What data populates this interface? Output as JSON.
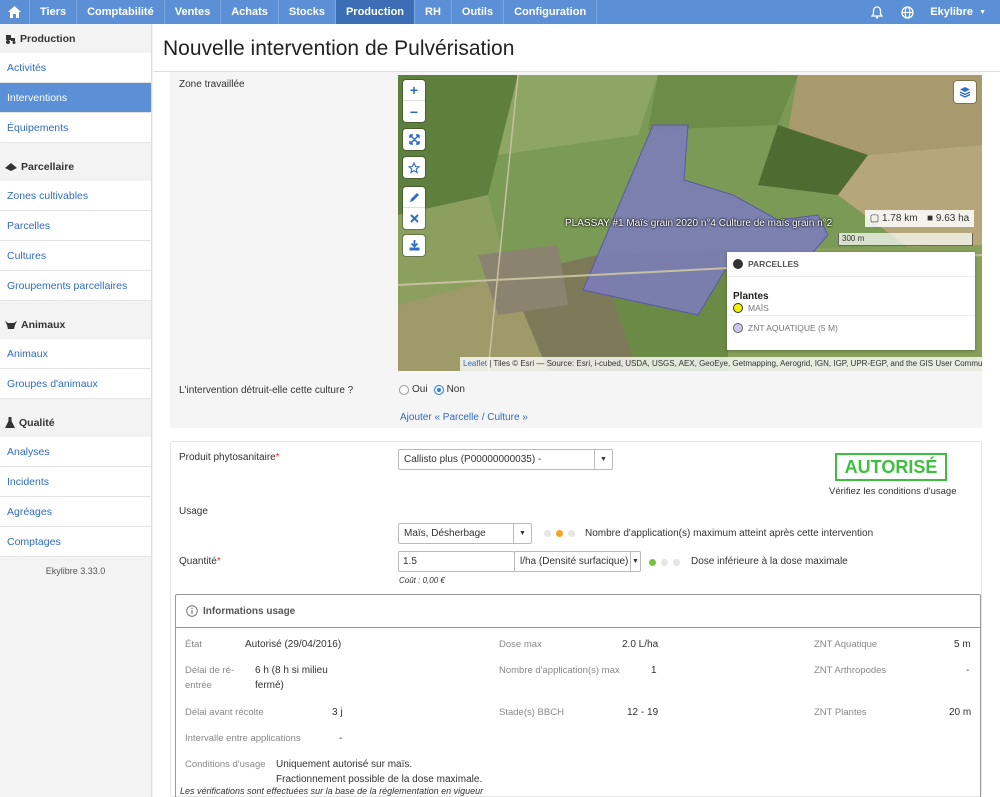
{
  "topnav": {
    "items": [
      "Tiers",
      "Comptabilité",
      "Ventes",
      "Achats",
      "Stocks",
      "Production",
      "RH",
      "Outils",
      "Configuration"
    ],
    "active": "Production",
    "user": "Ekylibre",
    "accent": "#5b8fd6"
  },
  "sidebar": {
    "sections": [
      {
        "title": "Production",
        "icon": "tractor-icon",
        "items": [
          "Activités",
          "Interventions",
          "Équipements"
        ],
        "active": "Interventions"
      },
      {
        "title": "Parcellaire",
        "icon": "land-icon",
        "items": [
          "Zones cultivables",
          "Parcelles",
          "Cultures",
          "Groupements parcellaires"
        ]
      },
      {
        "title": "Animaux",
        "icon": "cow-icon",
        "items": [
          "Animaux",
          "Groupes d'animaux"
        ]
      },
      {
        "title": "Qualité",
        "icon": "flask-icon",
        "items": [
          "Analyses",
          "Incidents",
          "Agréages",
          "Comptages"
        ]
      }
    ],
    "version": "Ekylibre 3.33.0"
  },
  "page": {
    "title": "Nouvelle intervention de Pulvérisation"
  },
  "zone": {
    "label": "Zone travaillée",
    "map_label": "PLASSAY #1 Maïs grain 2020 n°4 Culture de maïs grain n°2",
    "length": "1.78 km",
    "area": "9.63 ha",
    "scale": "300 m",
    "legend": {
      "parcelles": "PARCELLES",
      "plantes_title": "Plantes",
      "mais": "MAÏS",
      "znt": "ZNT AQUATIQUE (5 M)"
    },
    "attribution_link": "Leaflet",
    "attribution_text": " | Tiles © Esri — Source: Esri, i-cubed, USDA, USGS, AEX, GeoEye, Getmapping, Aerogrid, IGN, IGP, UPR-EGP, and the GIS User Community",
    "destroy_question": "L'intervention détruit-elle cette culture ?",
    "oui": "Oui",
    "non": "Non",
    "selected": "Non",
    "add_link": "Ajouter « Parcelle / Culture »"
  },
  "product": {
    "label": "Produit phytosanitaire",
    "required": "*",
    "value": "Callisto plus (P00000000035) -",
    "status": "AUTORISÉ",
    "status_color": "#3fbf3f",
    "status_note": "Vérifiez les conditions d'usage",
    "usage_label": "Usage",
    "usage_value": "Maïs, Désherbage",
    "usage_msg": "Nombre d'application(s) maximum atteint après cette intervention",
    "usage_indicator": "orange",
    "qty_label": "Quantité",
    "qty_value": "1.5",
    "unit_value": "l/ha (Densité surfacique)",
    "qty_msg": "Dose inférieure à la dose maximale",
    "qty_indicator": "green",
    "cost": "Coût : 0,00 €"
  },
  "info": {
    "title": "Informations usage",
    "etat_k": "État",
    "etat_v": "Autorisé (29/04/2016)",
    "dose_k": "Dose max",
    "dose_v": "2.0 L/ha",
    "znt_aq_k": "ZNT Aquatique",
    "znt_aq_v": "5 m",
    "delai_k1": "Délai de ré-",
    "delai_k2": "entrée",
    "delai_v1": "6 h (8 h si milieu",
    "delai_v2": "fermé)",
    "nb_app_k": "Nombre d'application(s) max",
    "nb_app_v": "1",
    "znt_ar_k": "ZNT Arthropodes",
    "znt_ar_v": "-",
    "recolte_k": "Délai avant récolte",
    "recolte_v": "3 j",
    "bbch_k": "Stade(s) BBCH",
    "bbch_v": "12 - 19",
    "znt_pl_k": "ZNT Plantes",
    "znt_pl_v": "20 m",
    "intervalle_k": "Intervalle entre applications",
    "intervalle_v": "-",
    "conditions_k": "Conditions d'usage",
    "conditions_v1": "Uniquement autorisé sur maïs.",
    "conditions_v2": "Fractionnement possible de la dose maximale."
  },
  "footnote": "Les vérifications sont effectuées sur la base de la réglementation en vigueur"
}
